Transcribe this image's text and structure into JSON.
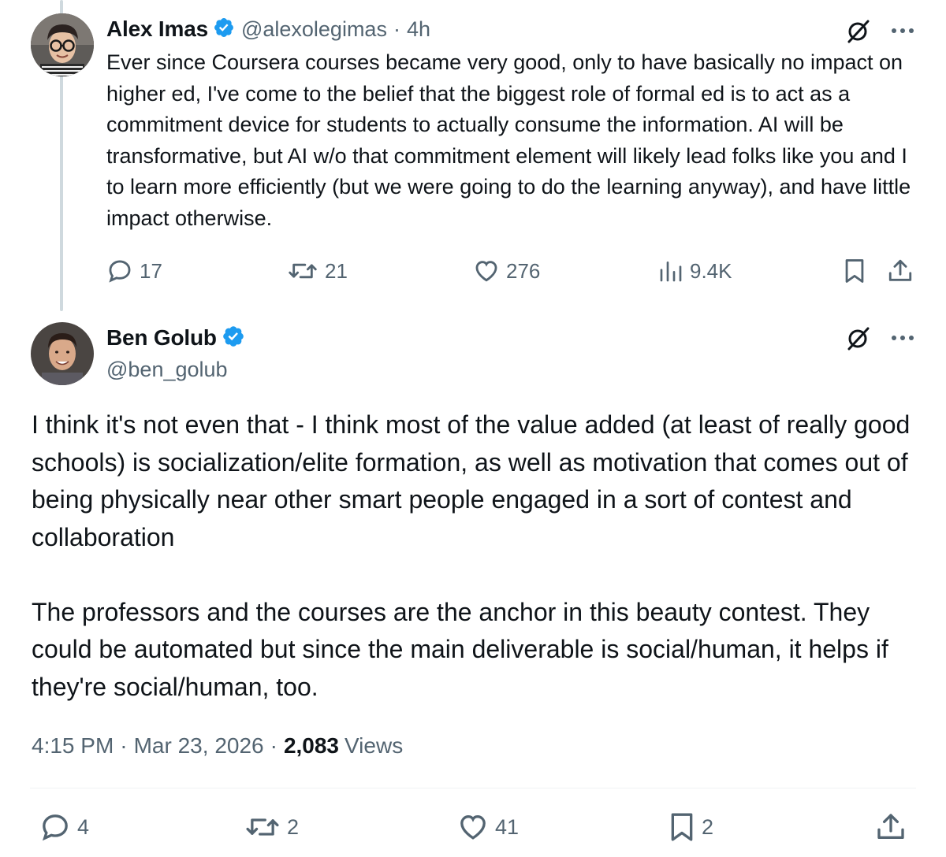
{
  "parent_post": {
    "author_name": "Alex Imas",
    "handle": "@alexolegimas",
    "separator": "·",
    "time": "4h",
    "body": "Ever since Coursera courses became very good, only to have basically no impact on higher ed, I've come to the belief that the biggest role of formal ed is to act as a commitment device for students to actually consume the information. AI will be transformative, but AI w/o that commitment element will likely lead folks like you and I to learn more efficiently (but we were going to do the learning anyway), and have little impact otherwise.",
    "replies": "17",
    "reposts": "21",
    "likes": "276",
    "views": "9.4K"
  },
  "main_post": {
    "author_name": "Ben Golub",
    "handle": "@ben_golub",
    "body": "I think it's not even that - I think most of the value added (at least of really good schools) is socialization/elite formation, as well as motivation that comes out of being physically near other smart people engaged in a sort of contest and collaboration\n\nThe professors and the courses are the anchor in this beauty contest. They could be automated but since the main deliverable is social/human, it helps if they're social/human, too.",
    "time": "4:15 PM",
    "date": "Mar 23, 2026",
    "dot": "·",
    "views_count": "2,083",
    "views_label": "Views",
    "replies": "4",
    "reposts": "2",
    "likes": "41",
    "bookmarks": "2"
  },
  "colors": {
    "text": "#0f1419",
    "muted": "#536471",
    "verified": "#1d9bf0",
    "thread_line": "#cfd9de",
    "divider": "#eff3f4"
  },
  "icons": [
    "grok-icon",
    "more-icon",
    "reply-icon",
    "repost-icon",
    "like-icon",
    "views-icon",
    "bookmark-icon",
    "share-icon",
    "verified-badge-icon"
  ]
}
